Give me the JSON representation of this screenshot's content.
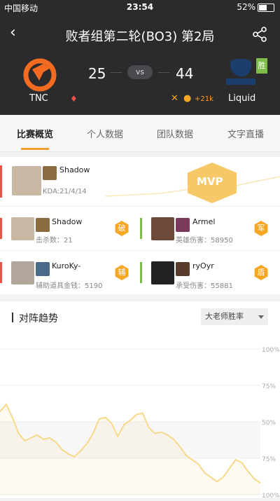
{
  "status_bar": {
    "carrier": "中国移动",
    "time": "23:54",
    "battery": "52%"
  },
  "header": {
    "title": "败者组第二轮(BO3) 第2局",
    "team_left": {
      "name": "TNC",
      "score": "25"
    },
    "team_right": {
      "name": "Liquid",
      "score": "44",
      "win_badge": "胜"
    },
    "vs": "vs",
    "gold_diff": "+21k"
  },
  "tabs": [
    {
      "label": "比赛概览"
    },
    {
      "label": "个人数据"
    },
    {
      "label": "团队数据"
    },
    {
      "label": "文字直播"
    }
  ],
  "mvp": {
    "name": "Shadow",
    "kda": "KDA:21/4/14",
    "badge": "MVP"
  },
  "players": [
    {
      "name": "Shadow",
      "stat": "击杀数：21",
      "tag": "破"
    },
    {
      "name": "Armel",
      "stat": "英雄伤害：58950",
      "tag": "军"
    },
    {
      "name": "KuroKy-",
      "stat": "辅助道具金钱：5190",
      "tag": "辅"
    },
    {
      "name": "ryOyr",
      "stat": "承受伤害：55881",
      "tag": "盾"
    }
  ],
  "trend": {
    "title": "对阵趋势",
    "select_value": "大老师胜率"
  },
  "chart_data": {
    "type": "line",
    "ylabel": "",
    "ytick_labels": [
      "100%",
      "75%",
      "50%",
      "75%",
      "100%"
    ],
    "series": [
      {
        "values": [
          0.57,
          0.62,
          0.53,
          0.42,
          0.37,
          0.39,
          0.41,
          0.38,
          0.39,
          0.36,
          0.31,
          0.28,
          0.26,
          0.3,
          0.35,
          0.42,
          0.52,
          0.53,
          0.49,
          0.4,
          0.48,
          0.51,
          0.55,
          0.56,
          0.46,
          0.42,
          0.43,
          0.41,
          0.38,
          0.33,
          0.27,
          0.24,
          0.21,
          0.15,
          0.12,
          0.09,
          0.12,
          0.18,
          0.24,
          0.22,
          0.16,
          0.11,
          0.08
        ]
      }
    ],
    "grid": true
  },
  "colors": {
    "accent": "#f5a623",
    "tnc_bar": "#e8534a",
    "liquid_bar": "#7fbd4a",
    "line": "#f8d98a"
  }
}
